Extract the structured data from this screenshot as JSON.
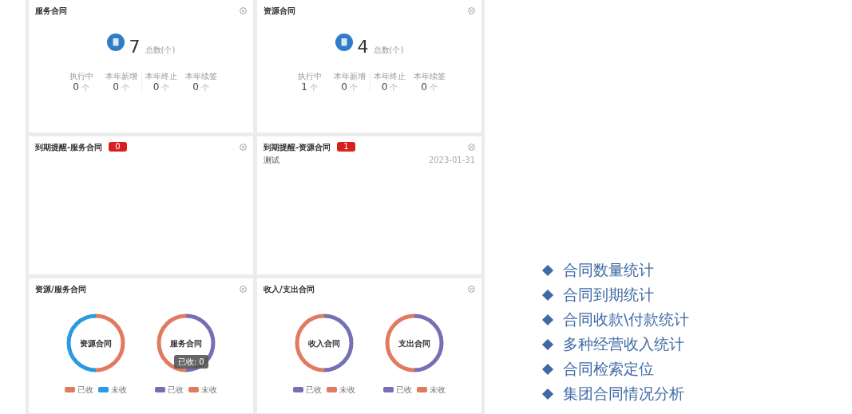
{
  "summary_cards": [
    {
      "title": "服务合同",
      "total": "7",
      "total_unit": "总数(个)",
      "stats": [
        {
          "label": "执行中",
          "value": "0",
          "unit": "个"
        },
        {
          "label": "本年新增",
          "value": "0",
          "unit": "个"
        },
        {
          "label": "本年终止",
          "value": "0",
          "unit": "个"
        },
        {
          "label": "本年续签",
          "value": "0",
          "unit": "个"
        }
      ]
    },
    {
      "title": "资源合同",
      "total": "4",
      "total_unit": "总数(个)",
      "stats": [
        {
          "label": "执行中",
          "value": "1",
          "unit": "个"
        },
        {
          "label": "本年新增",
          "value": "0",
          "unit": "个"
        },
        {
          "label": "本年终止",
          "value": "0",
          "unit": "个"
        },
        {
          "label": "本年续签",
          "value": "0",
          "unit": "个"
        }
      ]
    }
  ],
  "expiry_cards": [
    {
      "title": "到期提醒-服务合同",
      "badge": "0"
    },
    {
      "title": "到期提醒-资源合同",
      "badge": "1",
      "items": [
        {
          "name": "测试",
          "date": "2023-01-31"
        }
      ]
    }
  ],
  "chart_cards": [
    {
      "title": "资源/服务合同",
      "donuts": [
        {
          "label": "资源合同",
          "legend": [
            {
              "label": "已收",
              "color": "#e07b5f"
            },
            {
              "label": "未收",
              "color": "#2a9be0"
            }
          ]
        },
        {
          "label": "服务合同",
          "legend": [
            {
              "label": "已收",
              "color": "#7570b3"
            },
            {
              "label": "未收",
              "color": "#e07b5f"
            }
          ],
          "tooltip": "已收: 0"
        }
      ]
    },
    {
      "title": "收入/支出合同",
      "donuts": [
        {
          "label": "收入合同",
          "legend": [
            {
              "label": "已收",
              "color": "#7570b3"
            },
            {
              "label": "未收",
              "color": "#e07b5f"
            }
          ]
        },
        {
          "label": "支出合同",
          "legend": [
            {
              "label": "已收",
              "color": "#7570b3"
            },
            {
              "label": "未收",
              "color": "#e07b5f"
            }
          ]
        }
      ]
    }
  ],
  "features": [
    "合同数量统计",
    "合同到期统计",
    "合同收款\\付款统计",
    "多种经营收入统计",
    "合同检索定位",
    "集团合同情况分析"
  ]
}
